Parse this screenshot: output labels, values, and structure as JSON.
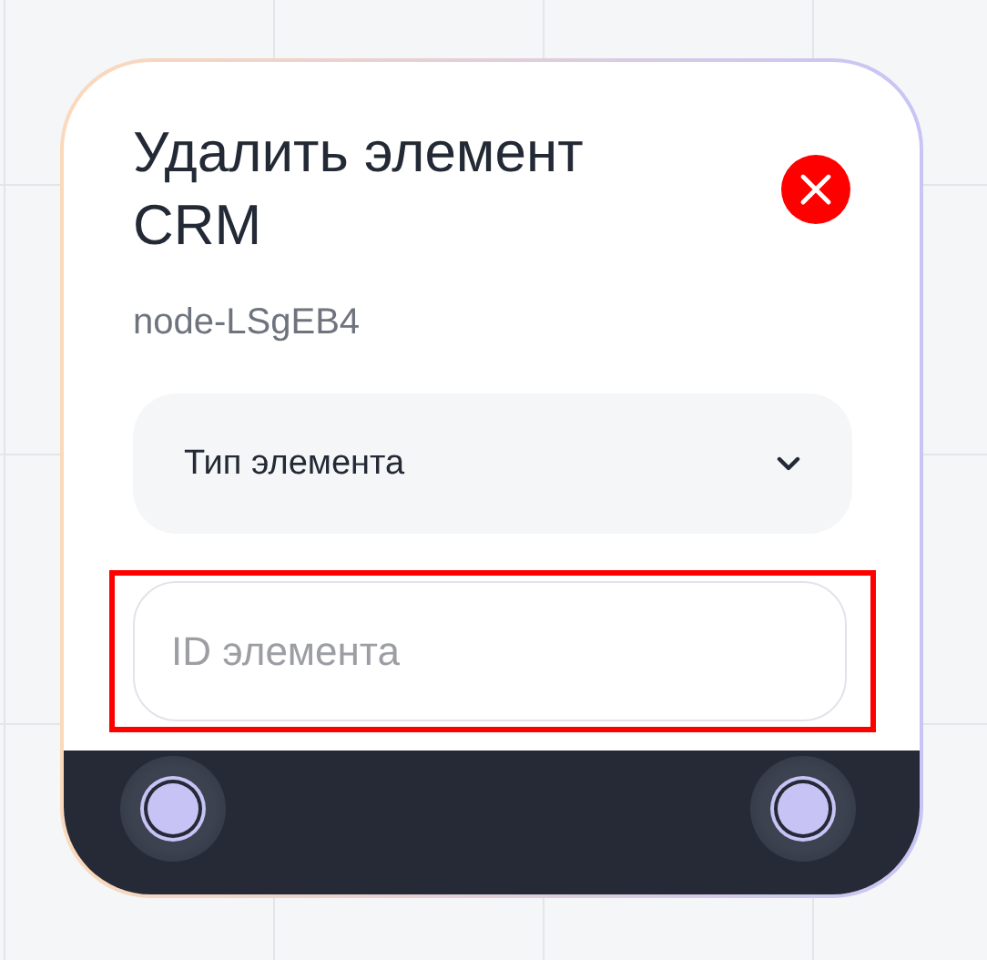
{
  "node": {
    "title": "Удалить элемент CRM",
    "node_id": "node-LSgEB4",
    "select": {
      "label": "Тип элемента",
      "expanded": false
    },
    "id_field": {
      "placeholder": "ID элемента",
      "highlighted": true
    }
  }
}
